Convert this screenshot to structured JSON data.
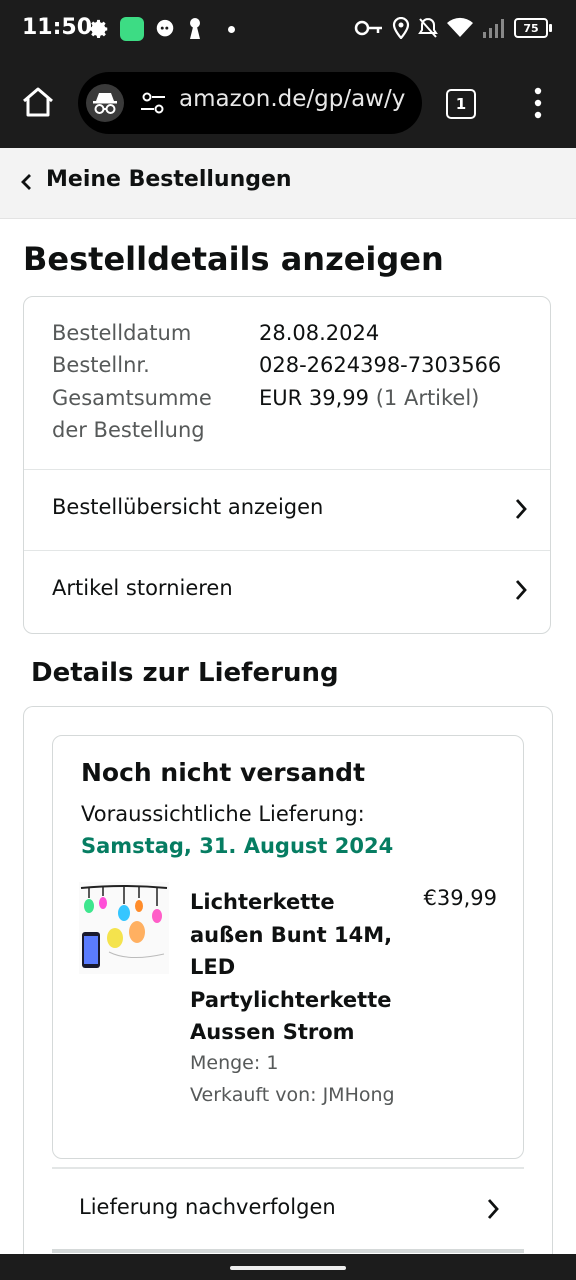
{
  "status_bar": {
    "time": "11:50",
    "battery": "75"
  },
  "browser": {
    "url": "amazon.de/gp/aw/y",
    "tab_count": "1"
  },
  "back_nav": {
    "label": "Meine Bestellungen"
  },
  "page": {
    "title": "Bestelldetails anzeigen"
  },
  "order_info": {
    "date_label": "Bestelldatum",
    "date_value": "28.08.2024",
    "number_label": "Bestellnr.",
    "number_value": "028-2624398-7303566",
    "total_label_line1": "Gesamtsumme",
    "total_label_line2": "der Bestellung",
    "total_value": "EUR 39,99",
    "total_count": "(1 Artikel)"
  },
  "order_links": {
    "summary": "Bestellübersicht anzeigen",
    "cancel": "Artikel stornieren"
  },
  "delivery": {
    "section_title": "Details zur Lieferung",
    "status": "Noch nicht versandt",
    "eta_label": "Voraussichtliche Lieferung:",
    "eta_date": "Samstag, 31. August 2024",
    "product": {
      "title": "Lichterkette außen Bunt 14M, LED Partylichterkette Aussen Strom",
      "price": "€39,99",
      "quantity": "Menge: 1",
      "seller": "Verkauft von: JMHong"
    },
    "track_label": "Lieferung nachverfolgen"
  },
  "colors": {
    "accent_green": "#067d62",
    "dark_bar": "#1c1c1c"
  }
}
